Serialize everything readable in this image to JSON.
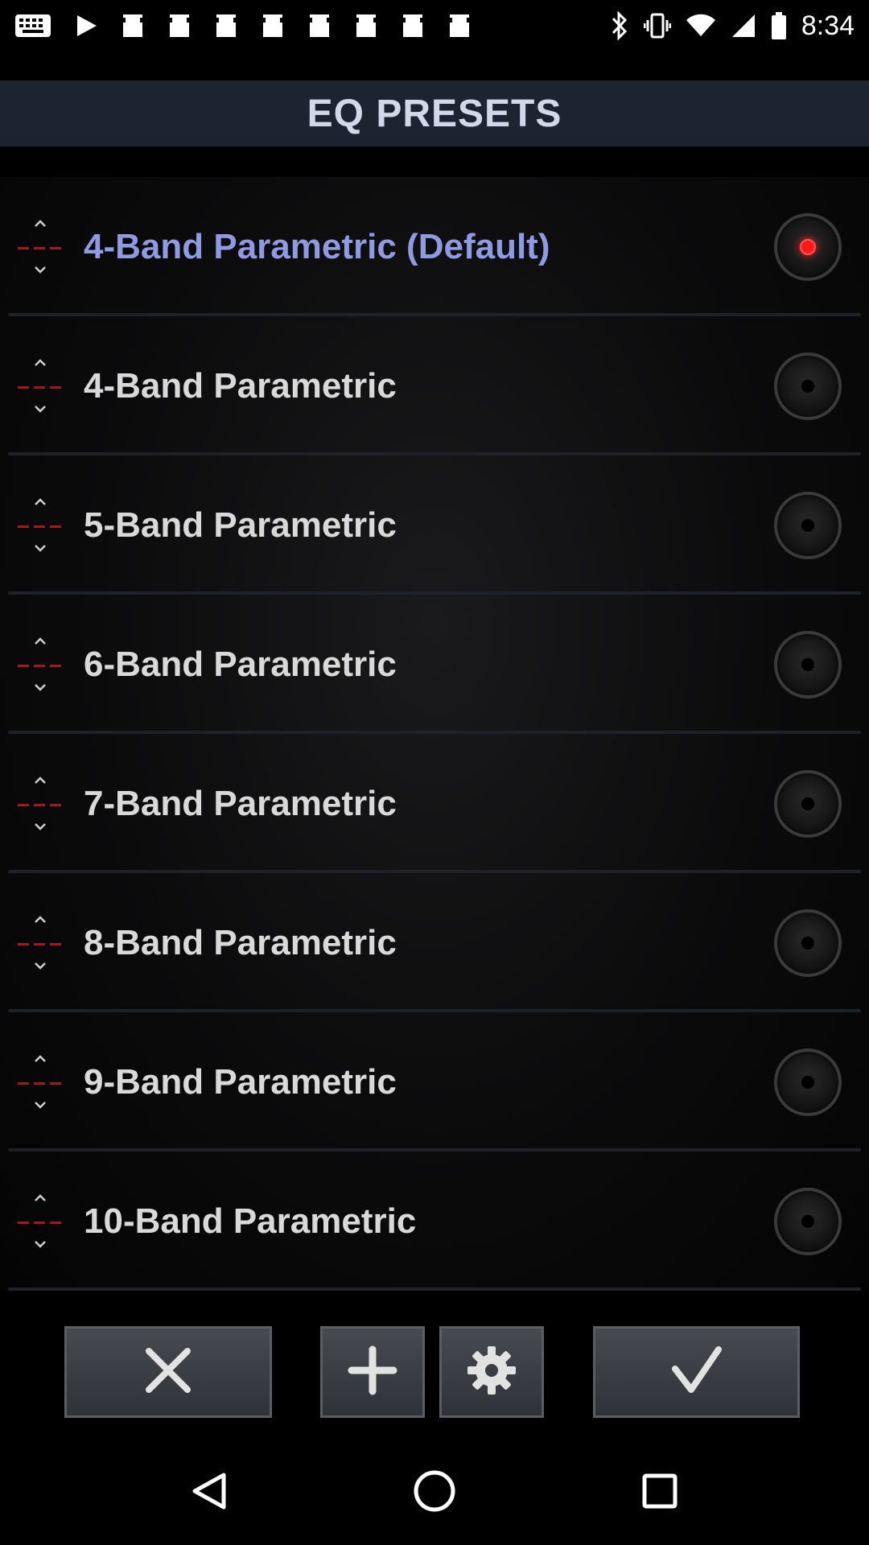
{
  "status_bar": {
    "time": "8:34",
    "left_icons": [
      "keyboard-icon",
      "play-icon",
      "image-icon",
      "image-icon",
      "image-icon",
      "image-icon",
      "image-icon",
      "image-icon",
      "image-icon",
      "image-icon"
    ],
    "right_icons": [
      "bluetooth-icon",
      "vibrate-icon",
      "wifi-icon",
      "signal-icon",
      "battery-icon"
    ]
  },
  "header": {
    "title": "EQ PRESETS"
  },
  "presets": [
    {
      "label": "4-Band Parametric (Default)",
      "selected": true
    },
    {
      "label": "4-Band Parametric",
      "selected": false
    },
    {
      "label": "5-Band Parametric",
      "selected": false
    },
    {
      "label": "6-Band Parametric",
      "selected": false
    },
    {
      "label": "7-Band Parametric",
      "selected": false
    },
    {
      "label": "8-Band Parametric",
      "selected": false
    },
    {
      "label": "9-Band Parametric",
      "selected": false
    },
    {
      "label": "10-Band Parametric",
      "selected": false
    }
  ],
  "toolbar": {
    "cancel_icon": "close-icon",
    "add_icon": "plus-icon",
    "settings_icon": "gear-icon",
    "confirm_icon": "check-icon"
  },
  "colors": {
    "accent_selected_text": "#8f9ae3",
    "selected_radio": "#ff1a1a",
    "header_bg": "#1c2431"
  },
  "nav_bar": {
    "icons": [
      "back-icon",
      "home-icon",
      "recents-icon"
    ]
  }
}
